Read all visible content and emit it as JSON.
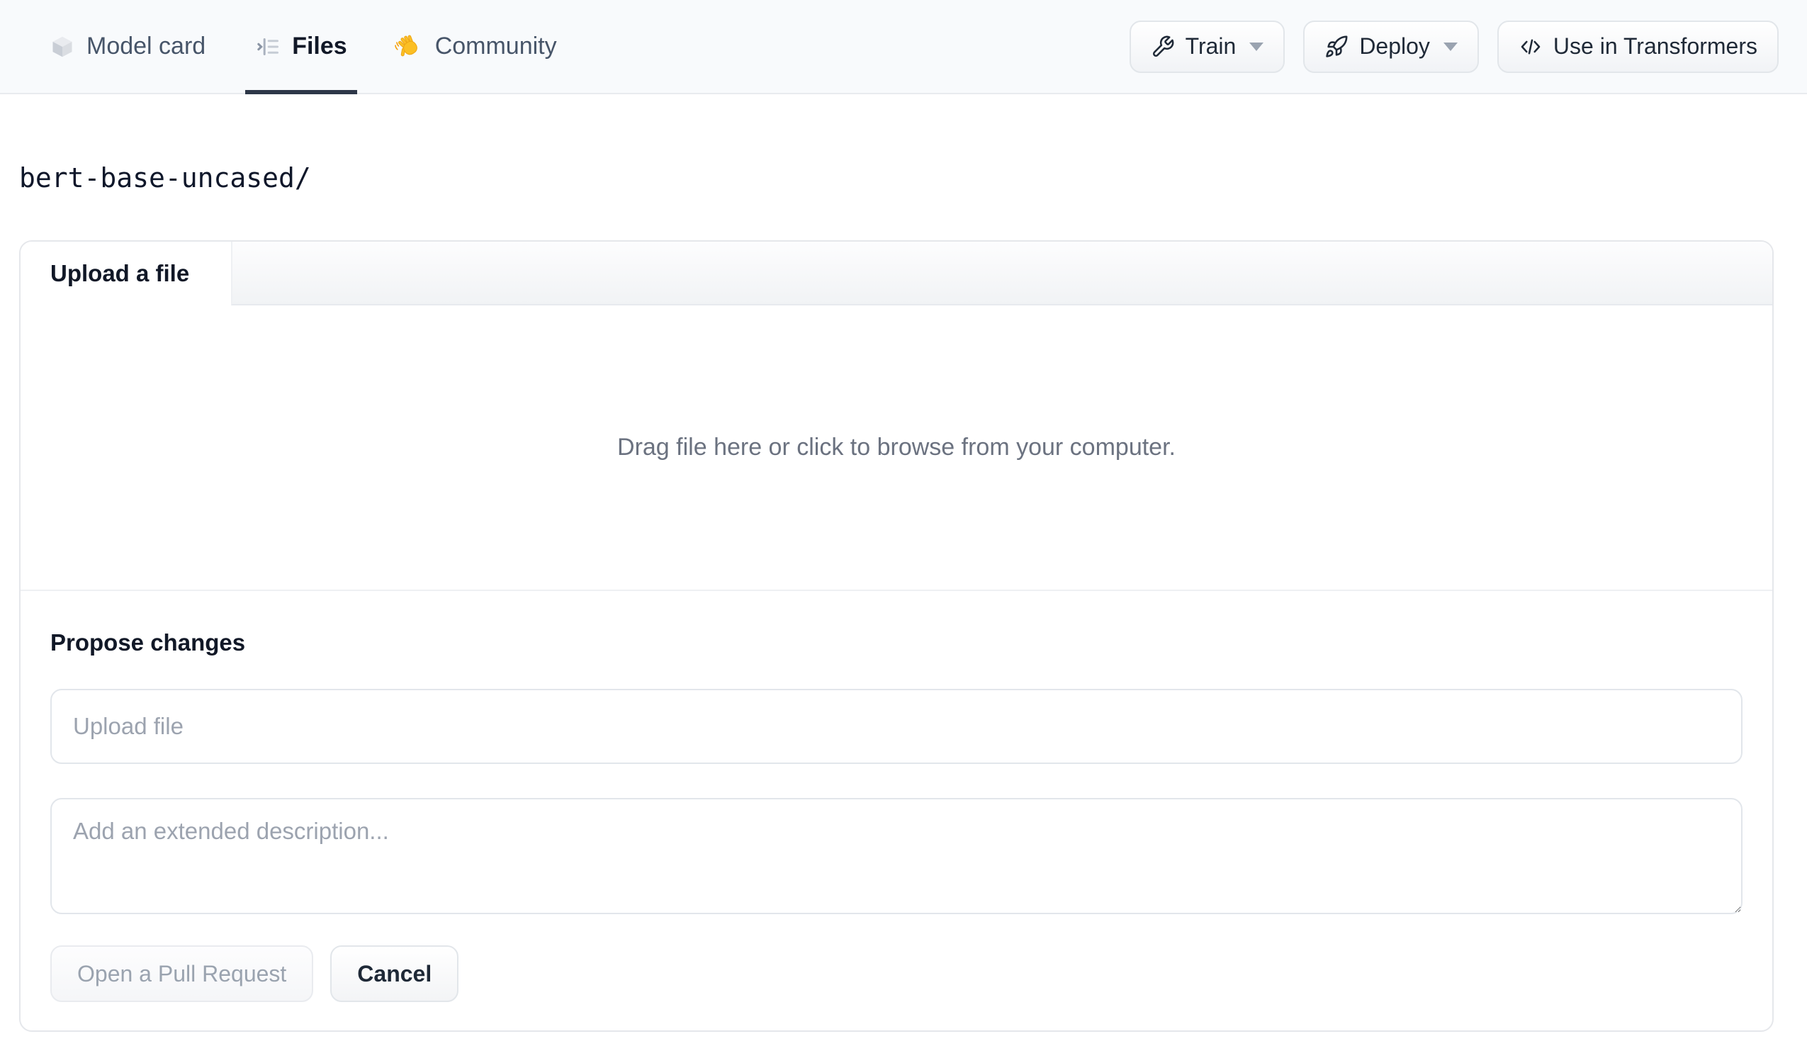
{
  "header": {
    "tabs": [
      {
        "label": "Model card",
        "icon": "cube-icon",
        "active": false
      },
      {
        "label": "Files",
        "icon": "file-list-icon",
        "active": true
      },
      {
        "label": "Community",
        "icon": "waving-hand-icon",
        "active": false
      }
    ],
    "actions": [
      {
        "label": "Train",
        "icon": "wrench-icon",
        "has_caret": true
      },
      {
        "label": "Deploy",
        "icon": "rocket-icon",
        "has_caret": true
      },
      {
        "label": "Use in Transformers",
        "icon": "code-icon",
        "has_caret": false
      }
    ]
  },
  "breadcrumb": {
    "path": "bert-base-uncased/"
  },
  "upload_card": {
    "tab_label": "Upload a file",
    "dropzone_text": "Drag file here or click to browse from your computer.",
    "propose": {
      "heading": "Propose changes",
      "file_input_placeholder": "Upload file",
      "description_placeholder": "Add an extended description...",
      "buttons": [
        {
          "label": "Open a Pull Request",
          "disabled": true
        },
        {
          "label": "Cancel",
          "disabled": false
        }
      ]
    }
  },
  "colors": {
    "topbar_bg": "#f8fafc",
    "active_tab_underline": "#2d3748",
    "waving_hand": "#fbbf24",
    "muted_text": "#6b7280",
    "placeholder_text": "#9ca3af"
  }
}
